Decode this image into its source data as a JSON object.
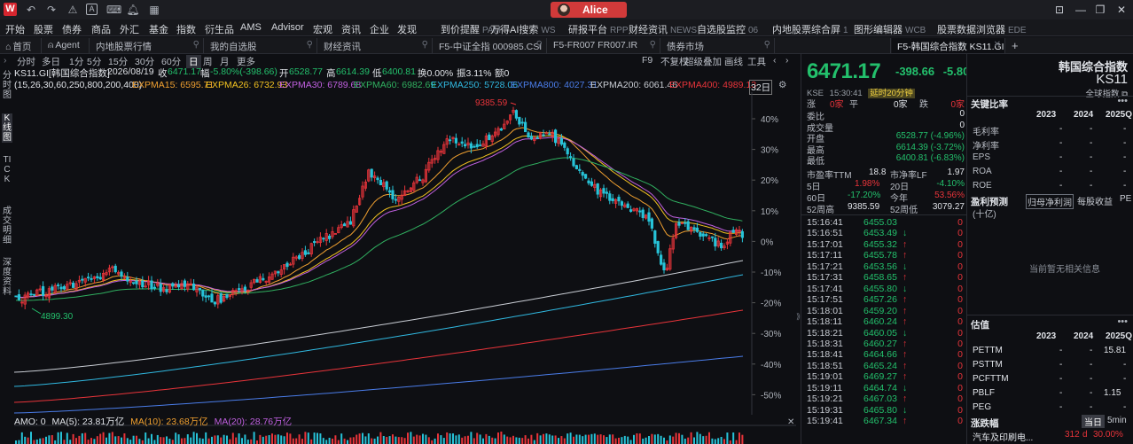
{
  "titlebar": {
    "logo": "W",
    "user": "Alice"
  },
  "menu": [
    {
      "label": "开始"
    },
    {
      "label": "股票"
    },
    {
      "label": "债券"
    },
    {
      "label": "商品"
    },
    {
      "label": "外汇"
    },
    {
      "label": "基金"
    },
    {
      "label": "指数"
    },
    {
      "label": "衍生品"
    },
    {
      "label": "AMS"
    },
    {
      "label": "Advisor"
    },
    {
      "label": "宏观"
    },
    {
      "label": "资讯"
    },
    {
      "label": "企业"
    },
    {
      "label": "发现"
    },
    {
      "label": "到价提醒",
      "sub": "PAM"
    },
    {
      "label": "万得AI搜索",
      "sub": "WS"
    },
    {
      "label": "研报平台",
      "sub": "RPP"
    },
    {
      "label": "财经资讯",
      "sub": "NEWS"
    },
    {
      "label": "自选股监控",
      "sub": "06"
    },
    {
      "label": "内地股票综合屏",
      "sub": "1"
    },
    {
      "label": "图形编辑器",
      "sub": "WCB"
    },
    {
      "label": "股票数据浏览器",
      "sub": "EDE"
    }
  ],
  "tabs": [
    {
      "label": "首页"
    },
    {
      "label": "Agent"
    },
    {
      "label": "内地股票行情"
    },
    {
      "label": "我的自选股"
    },
    {
      "label": "财经资讯"
    },
    {
      "label": "F5-中证全指 000985.CSI"
    },
    {
      "label": "F5-FR007 FR007.IR"
    },
    {
      "label": "债券市场"
    },
    {
      "label": ""
    },
    {
      "label": "F5-韩国综合指数 KS11.GI"
    }
  ],
  "periods": [
    "分时",
    "多日",
    "1分",
    "5分",
    "15分",
    "30分",
    "60分",
    "日",
    "周",
    "月",
    "更多"
  ],
  "chart_tools": [
    "F9",
    "不复权",
    "超级叠加",
    "画线",
    "工具"
  ],
  "left_nav": [
    "分时图",
    "K线图",
    "TICK",
    "成交明细",
    "深度资料"
  ],
  "info": {
    "code": "KS11.GI[韩国综合指数]",
    "date": "2026/08/19",
    "close_label": "收",
    "close": "6471.17",
    "amp_label": "幅",
    "amp": "-5.80%(-398.66)",
    "open_label": "开",
    "open": "6528.77",
    "high_label": "高",
    "high": "6614.39",
    "low_label": "低",
    "low": "6400.81",
    "turnover": "换0.00%",
    "swing": "振3.11%",
    "amount": "额0"
  },
  "ema": {
    "params": "(15,26,30,60,250,800,200,400)",
    "ema15": "EXPMA15: 6595.71",
    "ema26": "EXPMA26: 6732.93",
    "ema30": "EXPMA30: 6789.68",
    "ema60": "EXPMA60: 6982.69",
    "ema250": "EXPMA250: 5728.06",
    "ema800": "EXPMA800: 4027.31",
    "ema200": "EXPMA200: 6061.46",
    "ema400": "EXPMA400: 4989.13",
    "count": "32日"
  },
  "chart_data": {
    "type": "candlestick",
    "y_axis_ticks": [
      "40%",
      "30%",
      "20%",
      "10%",
      "0%",
      "-10%",
      "-20%",
      "-30%",
      "-40%",
      "-50%"
    ],
    "annotations": {
      "max": "9385.59",
      "min": "4899.30"
    },
    "colors": {
      "up": "#e8343a",
      "down": "#27c3d8"
    }
  },
  "volume": {
    "amo": "AMO: 0",
    "ma5": "MA(5): 23.81万亿",
    "ma10": "MA(10): 23.68万亿",
    "ma20": "MA(20): 28.76万亿"
  },
  "quote": {
    "price": "6471.17",
    "change": "-398.66",
    "pct": "-5.80%",
    "exchange": "KSE",
    "time": "15:30:41",
    "delay": "延时20分钟",
    "title": "韩国综合指数",
    "code": "KS11",
    "global": "全球指数",
    "breadth": {
      "label1": "涨",
      "up": "0家",
      "flat_label": "平",
      "flat": "0家",
      "down_label": "跌",
      "down": "0家"
    },
    "rows": [
      {
        "label": "委比",
        "value": "0"
      },
      {
        "label": "成交量",
        "value": "0"
      },
      {
        "label": "开盘",
        "value": "6528.77 (-4.96%)"
      },
      {
        "label": "最高",
        "value": "6614.39 (-3.72%)"
      },
      {
        "label": "最低",
        "value": "6400.81 (-6.83%)"
      }
    ],
    "pe_label": "市盈率TTM",
    "pe": "18.8",
    "pb_label": "市净率LF",
    "pb": "1.97",
    "d5_label": "5日",
    "d5": "1.98%",
    "d20_label": "20日",
    "d20": "-4.10%",
    "d60_label": "60日",
    "d60": "-17.20%",
    "ytd_label": "今年",
    "ytd": "53.56%",
    "w52h_label": "52周高",
    "w52h": "9385.59",
    "w52l_label": "52周低",
    "w52l": "3079.27",
    "ticks": [
      {
        "t": "15:16:41",
        "p": "6455.03",
        "a": "",
        "v": "0"
      },
      {
        "t": "15:16:51",
        "p": "6453.49",
        "a": "↓",
        "v": "0"
      },
      {
        "t": "15:17:01",
        "p": "6455.32",
        "a": "↑",
        "v": "0"
      },
      {
        "t": "15:17:11",
        "p": "6455.78",
        "a": "↑",
        "v": "0"
      },
      {
        "t": "15:17:21",
        "p": "6453.56",
        "a": "↓",
        "v": "0"
      },
      {
        "t": "15:17:31",
        "p": "6458.65",
        "a": "↑",
        "v": "0"
      },
      {
        "t": "15:17:41",
        "p": "6455.80",
        "a": "↓",
        "v": "0"
      },
      {
        "t": "15:17:51",
        "p": "6457.26",
        "a": "↑",
        "v": "0"
      },
      {
        "t": "15:18:01",
        "p": "6459.20",
        "a": "↑",
        "v": "0"
      },
      {
        "t": "15:18:11",
        "p": "6460.24",
        "a": "↑",
        "v": "0"
      },
      {
        "t": "15:18:21",
        "p": "6460.05",
        "a": "↓",
        "v": "0"
      },
      {
        "t": "15:18:31",
        "p": "6460.27",
        "a": "↑",
        "v": "0"
      },
      {
        "t": "15:18:41",
        "p": "6464.66",
        "a": "↑",
        "v": "0"
      },
      {
        "t": "15:18:51",
        "p": "6465.24",
        "a": "↑",
        "v": "0"
      },
      {
        "t": "15:19:01",
        "p": "6469.27",
        "a": "↑",
        "v": "0"
      },
      {
        "t": "15:19:11",
        "p": "6464.74",
        "a": "↓",
        "v": "0"
      },
      {
        "t": "15:19:21",
        "p": "6467.03",
        "a": "↑",
        "v": "0"
      },
      {
        "t": "15:19:31",
        "p": "6465.80",
        "a": "↓",
        "v": "0"
      },
      {
        "t": "15:19:41",
        "p": "6467.34",
        "a": "↑",
        "v": "0"
      }
    ]
  },
  "fund": {
    "key_ratio": "关键比率",
    "years": [
      "2023",
      "2024",
      "2025Q"
    ],
    "rows1": [
      {
        "label": "毛利率",
        "v": [
          "-",
          "-",
          "-"
        ]
      },
      {
        "label": "净利率",
        "v": [
          "-",
          "-",
          "-"
        ]
      },
      {
        "label": "EPS",
        "v": [
          "-",
          "-",
          "-"
        ]
      },
      {
        "label": "ROA",
        "v": [
          "-",
          "-",
          "-"
        ]
      },
      {
        "label": "ROE",
        "v": [
          "-",
          "-",
          "-"
        ]
      }
    ],
    "forecast": "盈利预测",
    "forecast_tabs": [
      "归母净利润",
      "每股收益",
      "PE"
    ],
    "unit": "(十亿)",
    "empty": "当前暂无相关信息",
    "valuation": "估值",
    "rows2": [
      {
        "label": "PETTM",
        "v": [
          "-",
          "-",
          "15.81"
        ]
      },
      {
        "label": "PSTTM",
        "v": [
          "-",
          "-",
          "-"
        ]
      },
      {
        "label": "PCFTTM",
        "v": [
          "-",
          "-",
          "-"
        ]
      },
      {
        "label": "PBLF",
        "v": [
          "-",
          "-",
          "1.15"
        ]
      },
      {
        "label": "PEG",
        "v": [
          "-",
          "-",
          "-"
        ]
      }
    ],
    "movers": "涨跌幅",
    "mover_tabs": [
      "当日",
      "5min"
    ],
    "mover_row": {
      "name": "汽车及印刷电...",
      "v1": "312",
      "unit": "d",
      "v2": "30.00%"
    }
  }
}
